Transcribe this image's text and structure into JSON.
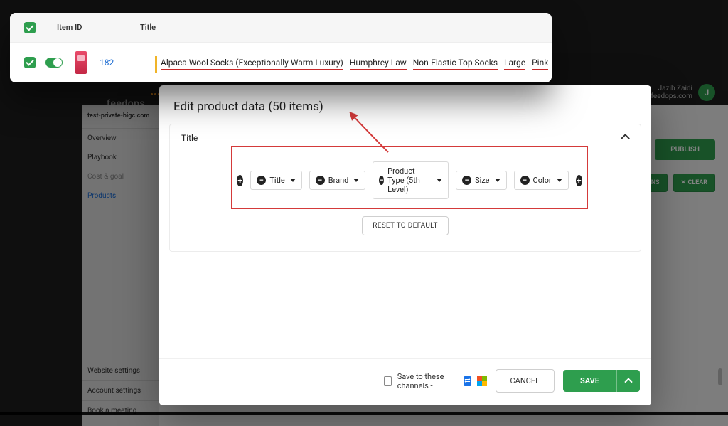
{
  "brand": {
    "name": "feedops",
    "site": "test-private-bigc.com"
  },
  "user": {
    "name": "Jazib Zaidi",
    "email": "@feedops.com",
    "avatar_initial": "J"
  },
  "sidebar": {
    "items": [
      {
        "label": "Overview"
      },
      {
        "label": "Playbook"
      },
      {
        "label": "Cost & goal"
      },
      {
        "label": "Products"
      }
    ],
    "bottom": [
      {
        "label": "Website settings"
      },
      {
        "label": "Account settings"
      },
      {
        "label": "Book a meeting"
      }
    ]
  },
  "actions": {
    "publish": "PUBLISH",
    "ns": "NS",
    "clear": "CLEAR"
  },
  "modal": {
    "title": "Edit product data (50 items)",
    "panel_title": "Title",
    "tokens": [
      {
        "label": "Title"
      },
      {
        "label": "Brand"
      },
      {
        "label": "Product Type (5th Level)"
      },
      {
        "label": "Size"
      },
      {
        "label": "Color"
      }
    ],
    "reset": "RESET TO DEFAULT",
    "save_to": "Save to these channels -",
    "cancel": "CANCEL",
    "save": "SAVE"
  },
  "table": {
    "col_item_id": "Item ID",
    "col_title": "Title",
    "row": {
      "id": "182",
      "title_segments": [
        "Alpaca Wool Socks (Exceptionally Warm Luxury)",
        "Humphrey Law",
        "Non-Elastic Top Socks",
        "Large",
        "Pink"
      ]
    }
  }
}
